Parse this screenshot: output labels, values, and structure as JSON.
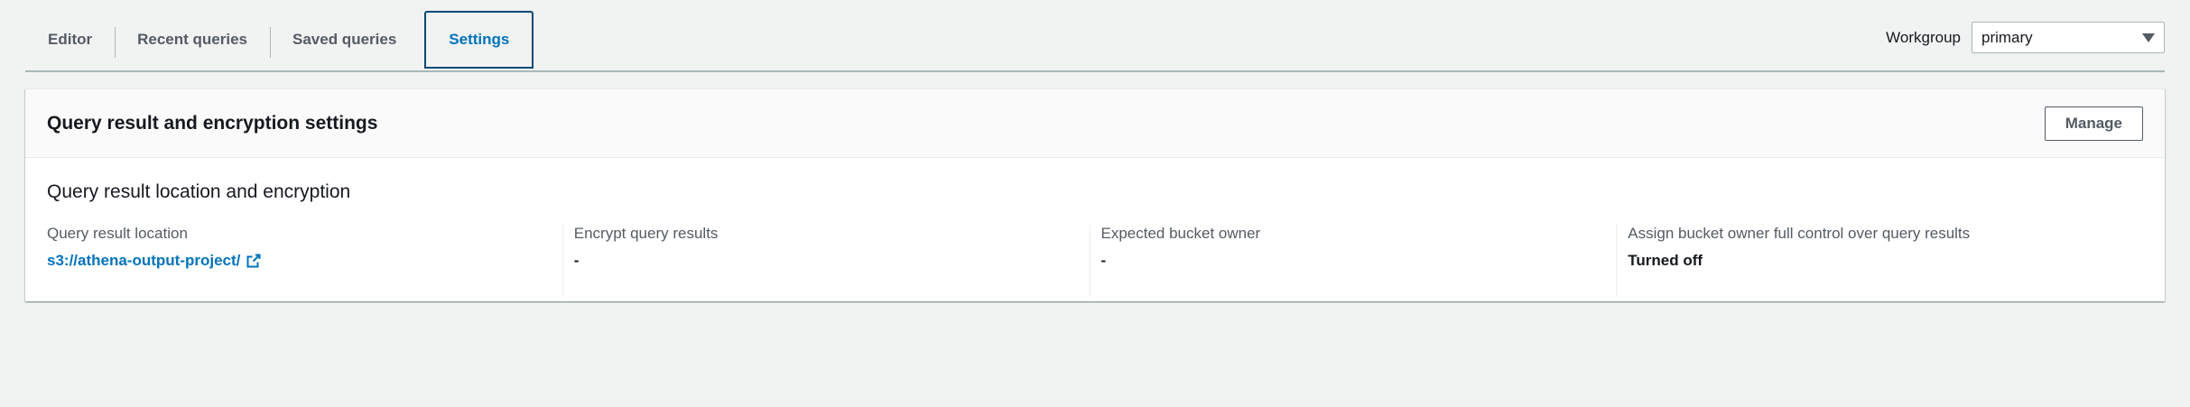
{
  "tabs": [
    {
      "label": "Editor"
    },
    {
      "label": "Recent queries"
    },
    {
      "label": "Saved queries"
    },
    {
      "label": "Settings"
    }
  ],
  "active_tab": "Settings",
  "workgroup": {
    "label": "Workgroup",
    "selected": "primary"
  },
  "panel": {
    "title": "Query result and encryption settings",
    "manage_label": "Manage",
    "section_title": "Query result location and encryption",
    "fields": [
      {
        "label": "Query result location",
        "value": "s3://athena-output-project/"
      },
      {
        "label": "Encrypt query results",
        "value": "-"
      },
      {
        "label": "Expected bucket owner",
        "value": "-"
      },
      {
        "label": "Assign bucket owner full control over query results",
        "value": "Turned off"
      }
    ]
  },
  "colors": {
    "accent": "#0073bb",
    "active_tab_border": "#0a4a74",
    "background": "#f1f2f2",
    "text": "#16191f",
    "muted": "#545b64"
  },
  "icons": {
    "external_link": "external-link-icon",
    "dropdown": "caret-down-icon"
  }
}
